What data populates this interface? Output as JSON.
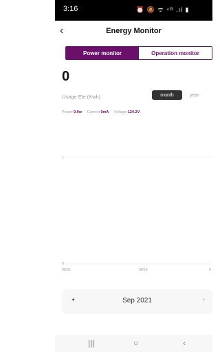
{
  "status_bar": {
    "time": "3:16",
    "icons_text": "⏰ 🔕 ᯤ ⁴ᴳ .ıl ▮"
  },
  "header": {
    "back_icon": "‹",
    "title": "Energy Monitor"
  },
  "tabs": [
    {
      "label": "Power monitor",
      "active": true
    },
    {
      "label": "Operation monitor",
      "active": false
    }
  ],
  "usage": {
    "value": "0",
    "label": "Usage Ele (Kwh)"
  },
  "period_toggle": {
    "month": "month",
    "year": "year",
    "selected": "month"
  },
  "readings": {
    "power_label": "Power:",
    "power_value": "0.0w",
    "current_label": "Current:",
    "current_value": "0mA",
    "voltage_label": "Voltage:",
    "voltage_value": "124.2V"
  },
  "chart_data": {
    "type": "bar",
    "x_tick_labels": [
      "09/01",
      "09/16",
      "0"
    ],
    "y_tick_labels": [
      "1",
      "0"
    ],
    "values": [],
    "ylim": [
      0,
      1
    ]
  },
  "date_nav": {
    "prev_icon": "◂",
    "label": "Sep 2021",
    "next_icon": "▸"
  },
  "system_nav": {
    "recent": "|||",
    "home": "○",
    "back": "‹"
  },
  "colors": {
    "accent": "#6a0f6a",
    "dark_button": "#333333"
  }
}
